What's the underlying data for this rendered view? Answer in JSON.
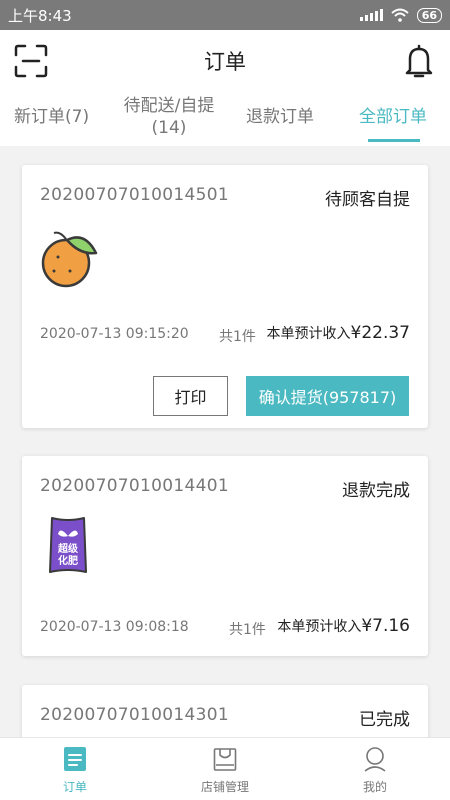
{
  "status_bar": {
    "time": "上午8:43",
    "battery": "66"
  },
  "header": {
    "title": "订单"
  },
  "tabs": [
    {
      "label": "新订单(7)"
    },
    {
      "label": "待配送/自提",
      "sub": "(14)"
    },
    {
      "label": "退款订单"
    },
    {
      "label": "全部订单",
      "active": true
    }
  ],
  "orders": [
    {
      "order_no": "20200707010014501",
      "status": "待顾客自提",
      "product_icon": "orange",
      "time": "2020-07-13 09:15:20",
      "qty": "共1件",
      "income_label": "本单预计收入",
      "amount": "¥22.37",
      "print_label": "打印",
      "confirm_label": "确认提货(957817)"
    },
    {
      "order_no": "20200707010014401",
      "status": "退款完成",
      "product_icon": "fertilizer-bag",
      "product_text": "超级化肥",
      "time": "2020-07-13 09:08:18",
      "qty": "共1件",
      "income_label": "本单预计收入",
      "amount": "¥7.16"
    },
    {
      "order_no": "20200707010014301",
      "status": "已完成"
    }
  ],
  "bottom_nav": [
    {
      "label": "订单",
      "icon": "order-list-icon",
      "active": true
    },
    {
      "label": "店铺管理",
      "icon": "shop-bag-icon"
    },
    {
      "label": "我的",
      "icon": "user-icon"
    }
  ],
  "colors": {
    "accent": "#4ab9c1",
    "status_bar": "#7a7a7a"
  }
}
